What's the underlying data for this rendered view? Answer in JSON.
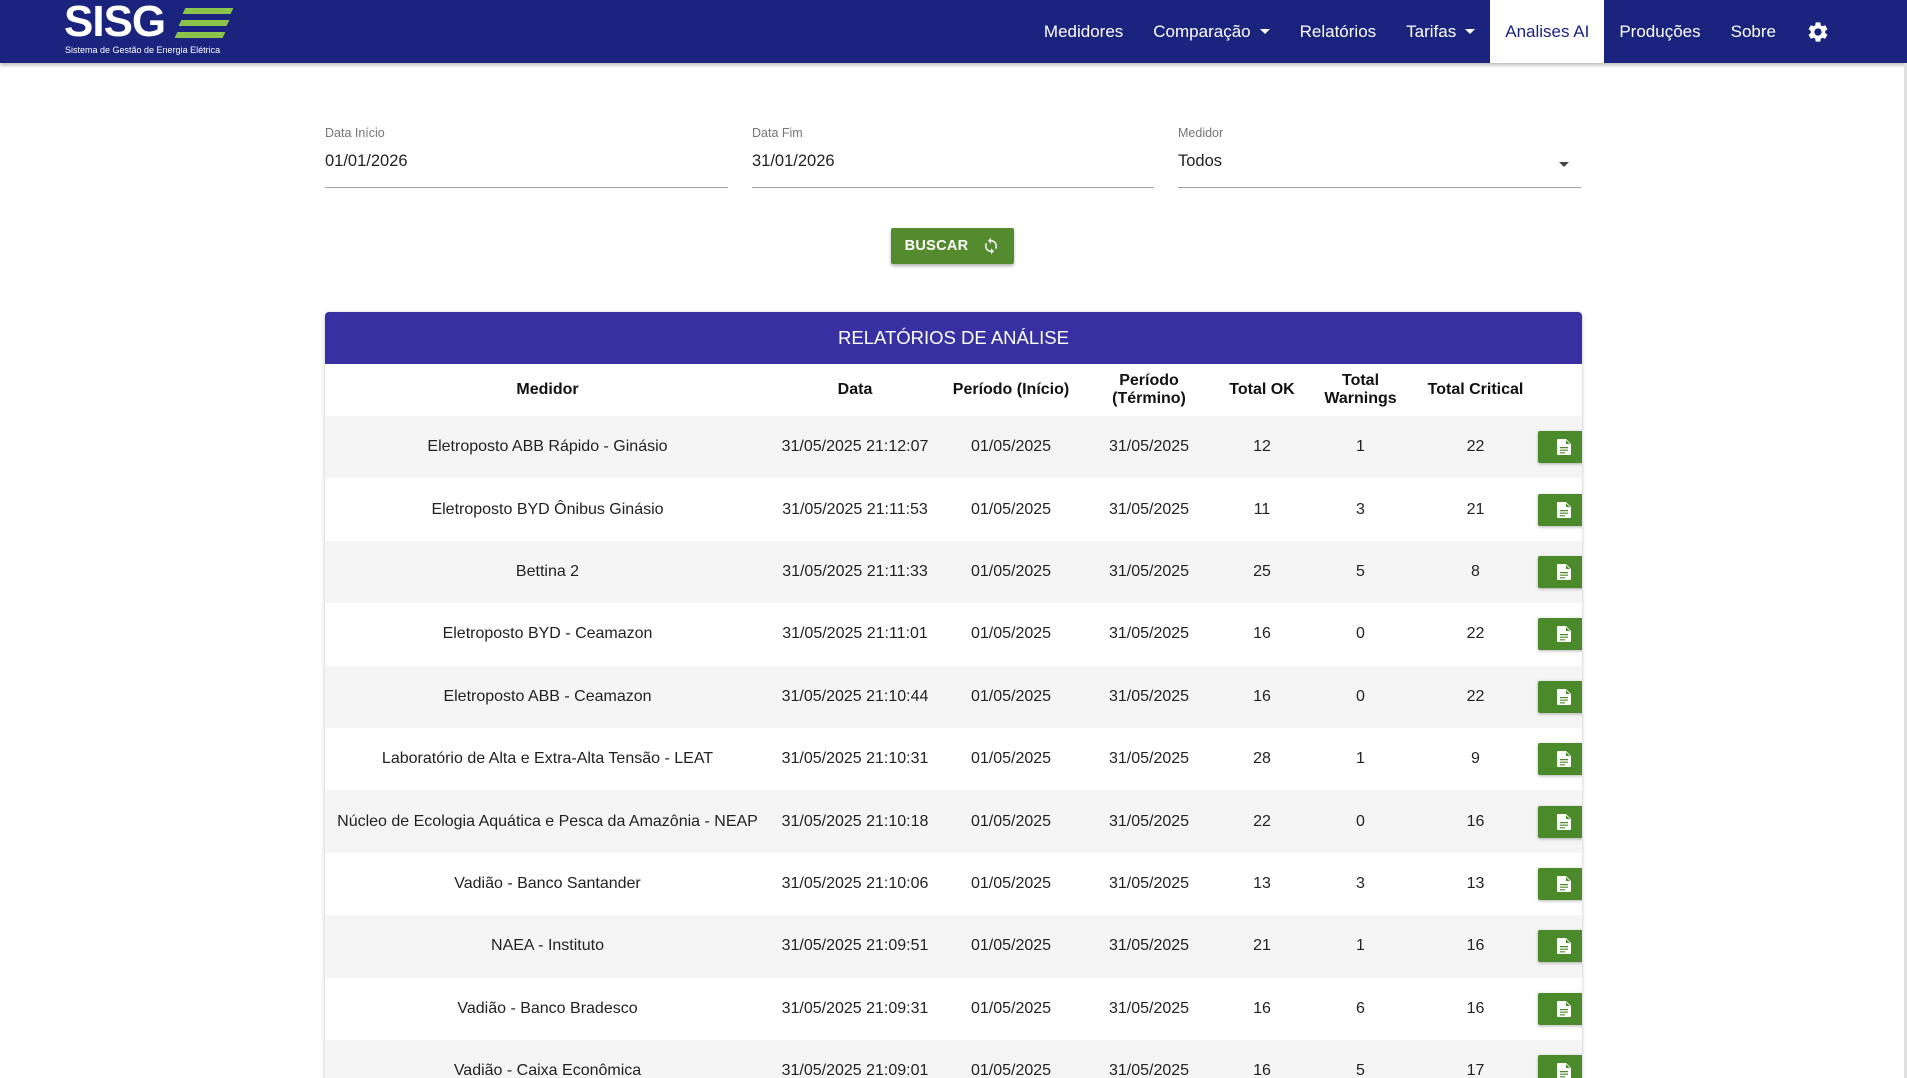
{
  "brand": {
    "name": "SISG",
    "subtitle": "Sistema de Gestão de Energia Elétrica"
  },
  "nav": {
    "items": [
      {
        "label": "Medidores",
        "dropdown": false,
        "active": false
      },
      {
        "label": "Comparação",
        "dropdown": true,
        "active": false
      },
      {
        "label": "Relatórios",
        "dropdown": false,
        "active": false
      },
      {
        "label": "Tarifas",
        "dropdown": true,
        "active": false
      },
      {
        "label": "Analises AI",
        "dropdown": false,
        "active": true
      },
      {
        "label": "Produções",
        "dropdown": false,
        "active": false
      },
      {
        "label": "Sobre",
        "dropdown": false,
        "active": false
      }
    ],
    "settings_icon": "gear-icon"
  },
  "filters": {
    "start": {
      "label": "Data Início",
      "value": "01/01/2026"
    },
    "end": {
      "label": "Data Fim",
      "value": "31/01/2026"
    },
    "meter": {
      "label": "Medidor",
      "value": "Todos"
    }
  },
  "search_button": {
    "label": "BUSCAR",
    "icon": "refresh-icon"
  },
  "colors": {
    "navbar": "#1a237e",
    "card_header": "#3730a3",
    "button_green": "#558b2f",
    "logo_accent": "#8bc34a"
  },
  "report_table": {
    "title": "RELATÓRIOS DE ANÁLISE",
    "columns": [
      "Medidor",
      "Data",
      "Período (Início)",
      "Período (Término)",
      "Total OK",
      "Total Warnings",
      "Total Critical",
      ""
    ],
    "action_icon": "document-icon",
    "rows": [
      [
        "Eletroposto ABB Rápido - Ginásio",
        "31/05/2025 21:12:07",
        "01/05/2025",
        "31/05/2025",
        "12",
        "1",
        "22"
      ],
      [
        "Eletroposto BYD Ônibus Ginásio",
        "31/05/2025 21:11:53",
        "01/05/2025",
        "31/05/2025",
        "11",
        "3",
        "21"
      ],
      [
        "Bettina 2",
        "31/05/2025 21:11:33",
        "01/05/2025",
        "31/05/2025",
        "25",
        "5",
        "8"
      ],
      [
        "Eletroposto BYD - Ceamazon",
        "31/05/2025 21:11:01",
        "01/05/2025",
        "31/05/2025",
        "16",
        "0",
        "22"
      ],
      [
        "Eletroposto ABB - Ceamazon",
        "31/05/2025 21:10:44",
        "01/05/2025",
        "31/05/2025",
        "16",
        "0",
        "22"
      ],
      [
        "Laboratório de Alta e Extra-Alta Tensão - LEAT",
        "31/05/2025 21:10:31",
        "01/05/2025",
        "31/05/2025",
        "28",
        "1",
        "9"
      ],
      [
        "Núcleo de Ecologia Aquática e Pesca da Amazônia - NEAP",
        "31/05/2025 21:10:18",
        "01/05/2025",
        "31/05/2025",
        "22",
        "0",
        "16"
      ],
      [
        "Vadião - Banco Santander",
        "31/05/2025 21:10:06",
        "01/05/2025",
        "31/05/2025",
        "13",
        "3",
        "13"
      ],
      [
        "NAEA - Instituto",
        "31/05/2025 21:09:51",
        "01/05/2025",
        "31/05/2025",
        "21",
        "1",
        "16"
      ],
      [
        "Vadião - Banco Bradesco",
        "31/05/2025 21:09:31",
        "01/05/2025",
        "31/05/2025",
        "16",
        "6",
        "16"
      ],
      [
        "Vadião - Caixa Econômica",
        "31/05/2025 21:09:01",
        "01/05/2025",
        "31/05/2025",
        "16",
        "5",
        "17"
      ]
    ]
  }
}
